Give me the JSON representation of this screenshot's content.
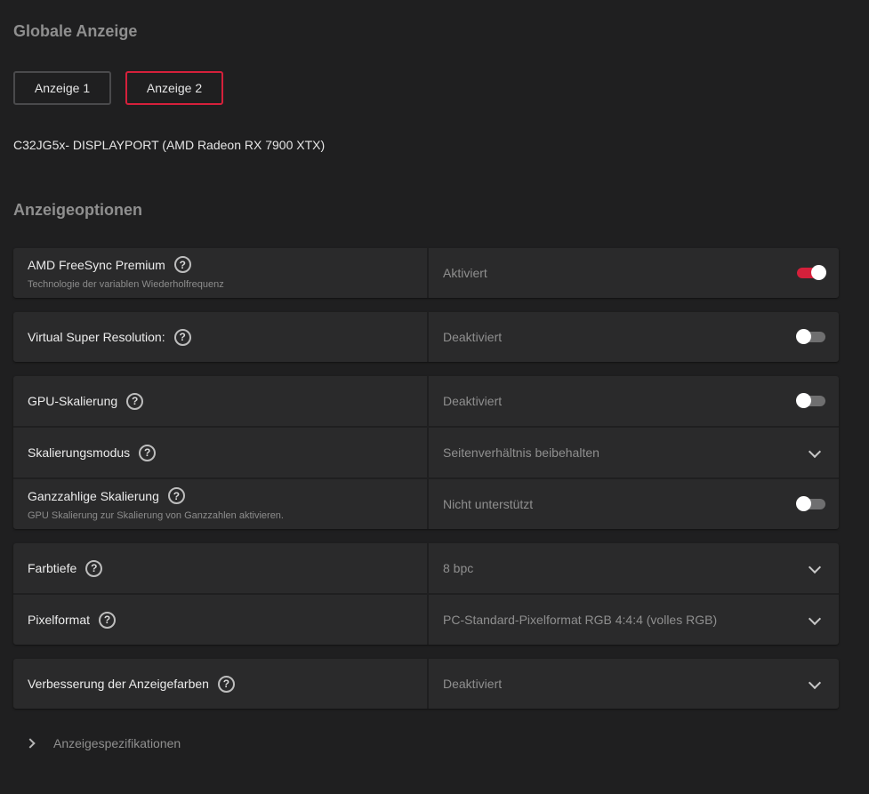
{
  "global_display": {
    "title": "Globale Anzeige",
    "buttons": [
      {
        "label": "Anzeige 1",
        "selected": false
      },
      {
        "label": "Anzeige 2",
        "selected": true
      }
    ],
    "monitor_name": "C32JG5x- DISPLAYPORT (AMD Radeon RX 7900 XTX)"
  },
  "display_options": {
    "title": "Anzeigeoptionen",
    "help_glyph": "?",
    "freesync": {
      "label": "AMD FreeSync Premium",
      "sub": "Technologie der variablen Wiederholfrequenz",
      "value": "Aktiviert",
      "toggle_on": true
    },
    "vsr": {
      "label": "Virtual Super Resolution:",
      "value": "Deaktiviert",
      "toggle_on": false
    },
    "gpu_scaling": {
      "label": "GPU-Skalierung",
      "value": "Deaktiviert",
      "toggle_on": false
    },
    "scaling_mode": {
      "label": "Skalierungsmodus",
      "value": "Seitenverhältnis beibehalten"
    },
    "integer_scaling": {
      "label": "Ganzzahlige Skalierung",
      "sub": "GPU Skalierung zur Skalierung von Ganzzahlen aktivieren.",
      "value": "Nicht unterstützt",
      "toggle_on": false
    },
    "color_depth": {
      "label": "Farbtiefe",
      "value": "8 bpc"
    },
    "pixel_format": {
      "label": "Pixelformat",
      "value": "PC-Standard-Pixelformat RGB 4:4:4 (volles RGB)"
    },
    "color_enhancement": {
      "label": "Verbesserung der Anzeigefarben",
      "value": "Deaktiviert"
    }
  },
  "specs": {
    "label": "Anzeigespezifikationen"
  },
  "colors": {
    "accent": "#d5203b",
    "background": "#1f1f20",
    "panel": "#2a2a2b"
  },
  "icons": {
    "help": "question-circle-icon",
    "dropdown": "chevron-down-icon",
    "expand": "chevron-right-icon"
  }
}
